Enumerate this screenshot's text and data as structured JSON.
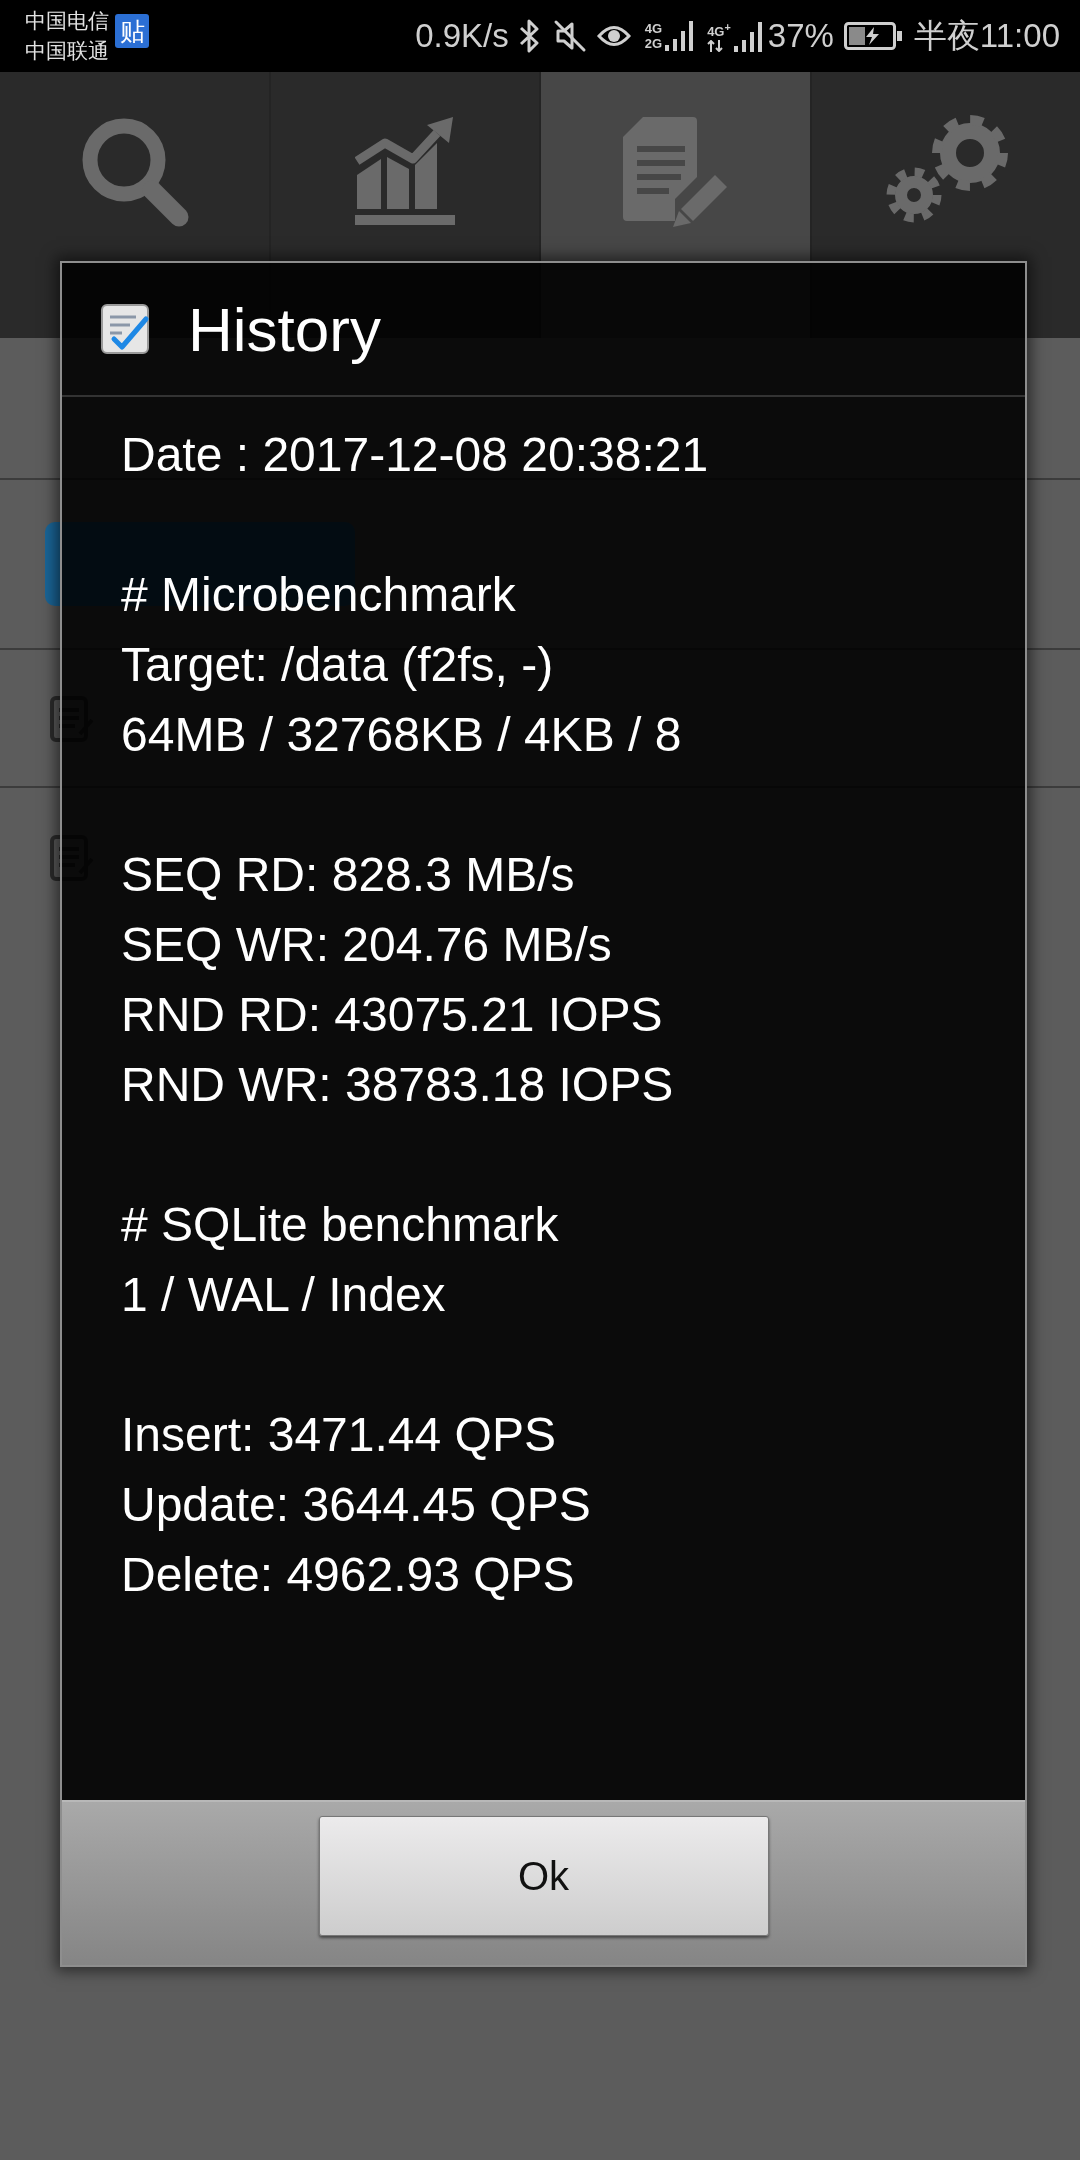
{
  "status_bar": {
    "carriers": [
      "中国电信",
      "中国联通"
    ],
    "notification": "贴",
    "network_speed": "0.9K/s",
    "sim_1_network": [
      "4G",
      "2G"
    ],
    "sim_2_network": "4G$^{+}$",
    "battery": "37%",
    "time": "半夜11:00"
  },
  "tabs": [
    {
      "selected": false
    },
    {
      "selected": false
    },
    {
      "selected": true
    },
    {
      "selected": false
    }
  ],
  "dialog": {
    "title": "History",
    "sections": [
      [
        "Date : 2017-12-08 20:38:21"
      ],
      [
        "# Microbenchmark",
        "Target: /data (f2fs, -)",
        "64MB / 32768KB / 4KB / 8"
      ],
      [
        "SEQ RD: 828.3 MB/s",
        "SEQ WR: 204.76 MB/s",
        "RND RD: 43075.21 IOPS",
        "RND WR: 38783.18 IOPS"
      ],
      [
        "# SQLite benchmark",
        "1 / WAL / Index"
      ],
      [
        "Insert: 3471.44 QPS",
        "Update: 3644.45 QPS",
        "Delete: 4962.93 QPS"
      ]
    ],
    "button": "Ok"
  }
}
